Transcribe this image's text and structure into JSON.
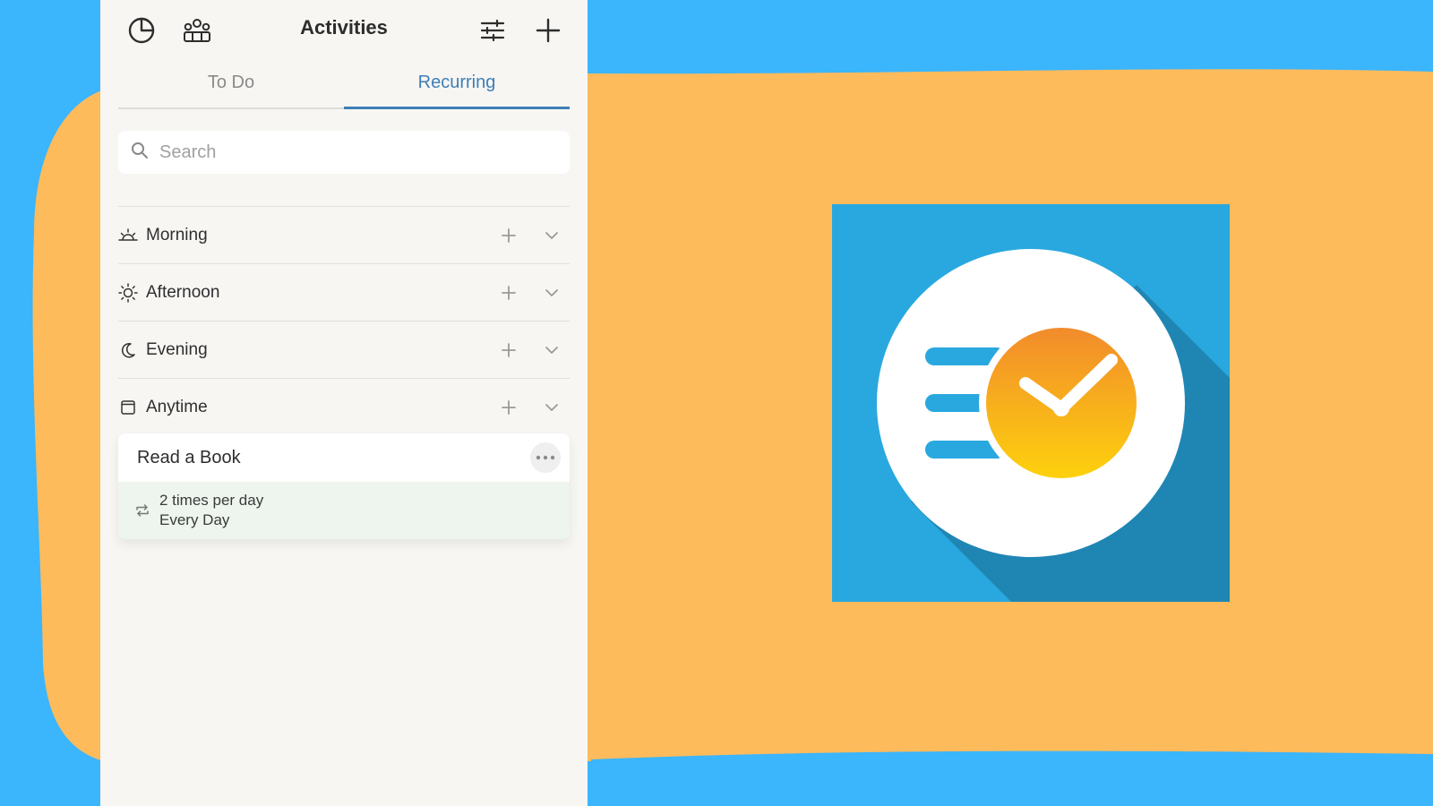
{
  "header": {
    "title": "Activities"
  },
  "tabs": [
    {
      "label": "To Do",
      "active": false
    },
    {
      "label": "Recurring",
      "active": true
    }
  ],
  "search": {
    "placeholder": "Search",
    "value": ""
  },
  "sections": [
    {
      "label": "Morning",
      "icon": "sunrise-icon"
    },
    {
      "label": "Afternoon",
      "icon": "sun-icon"
    },
    {
      "label": "Evening",
      "icon": "moon-icon"
    },
    {
      "label": "Anytime",
      "icon": "square-icon"
    }
  ],
  "activity": {
    "title": "Read a Book",
    "frequency": "2 times per day",
    "schedule": "Every Day"
  },
  "colors": {
    "background_blue": "#3bb5fb",
    "backdrop_orange": "#fdbb5c",
    "accent": "#3f7fb6",
    "logo_blue": "#29a8df",
    "logo_orange": "#f4a024"
  }
}
